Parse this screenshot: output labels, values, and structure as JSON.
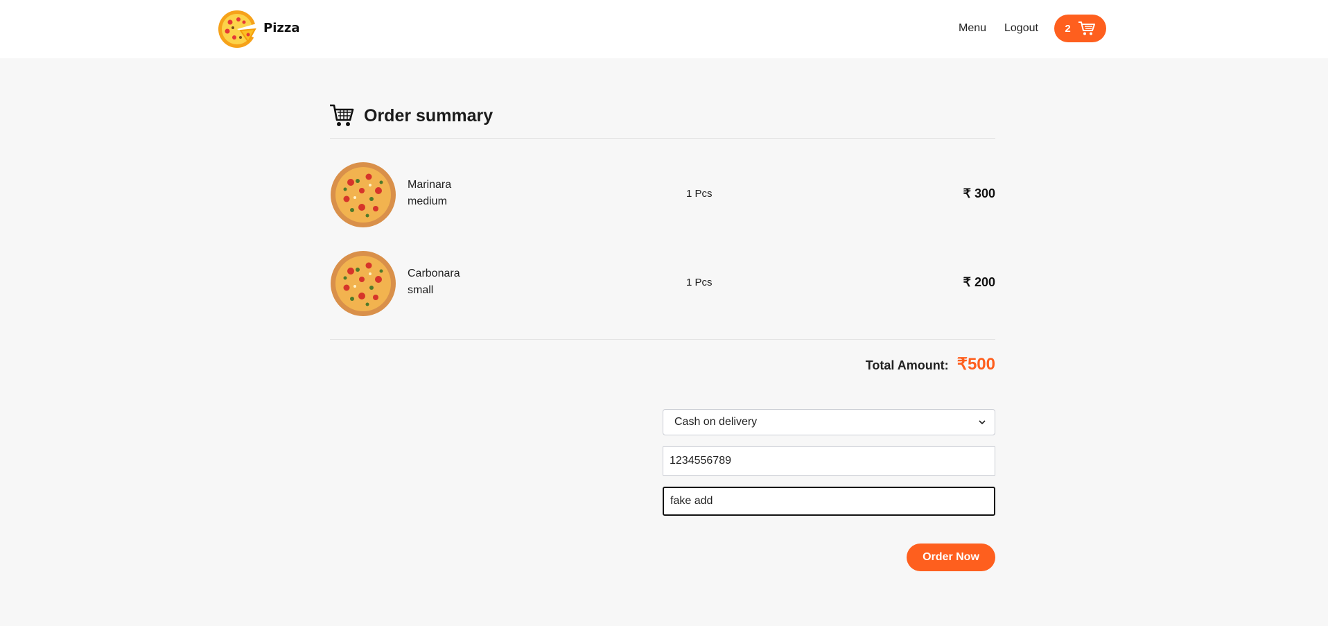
{
  "header": {
    "brand": "Pizza",
    "logo_icon": "pizza-logo-icon",
    "nav": {
      "menu": "Menu",
      "logout": "Logout"
    },
    "cart": {
      "count": "2",
      "icon": "cart-icon"
    }
  },
  "summary": {
    "title": "Order summary",
    "icon": "cart-icon"
  },
  "items": [
    {
      "name": "Marinara",
      "size": "medium",
      "qty": "1 Pcs",
      "price": "₹ 300"
    },
    {
      "name": "Carbonara",
      "size": "small",
      "qty": "1 Pcs",
      "price": "₹ 200"
    }
  ],
  "total": {
    "label": "Total Amount:",
    "value": "₹500"
  },
  "form": {
    "payment_selected": "Cash on delivery",
    "phone_value": "1234556789",
    "address_value": "fake add",
    "submit_label": "Order Now"
  },
  "colors": {
    "accent": "#fe5f1e",
    "page_bg": "#f7f7f7",
    "header_bg": "#ffffff"
  }
}
